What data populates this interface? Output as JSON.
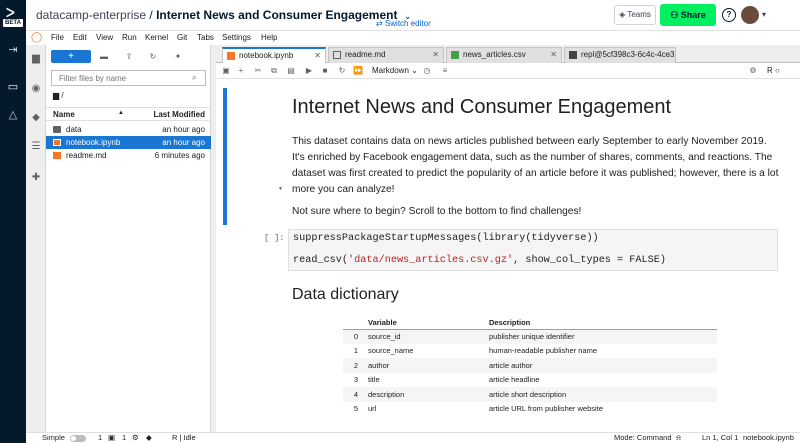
{
  "rail": {
    "beta": "BETA"
  },
  "header": {
    "workspace": "datacamp-enterprise",
    "separator": "/",
    "title": "Internet News and Consumer Engagement",
    "switch_editor": "Switch editor",
    "teams": "Teams",
    "share": "Share",
    "help": "?"
  },
  "menu": [
    "File",
    "Edit",
    "View",
    "Run",
    "Kernel",
    "Git",
    "Tabs",
    "Settings",
    "Help"
  ],
  "filebrowser": {
    "new_button": "+",
    "filter_placeholder": "Filter files by name",
    "path": "/",
    "col_name": "Name",
    "col_modified": "Last Modified",
    "files": [
      {
        "name": "data",
        "modified": "an hour ago",
        "type": "folder"
      },
      {
        "name": "notebook.ipynb",
        "modified": "an hour ago",
        "type": "notebook"
      },
      {
        "name": "readme.md",
        "modified": "6 minutes ago",
        "type": "markdown"
      }
    ]
  },
  "tabs": [
    {
      "label": "notebook.ipynb"
    },
    {
      "label": "readme.md"
    },
    {
      "label": "news_articles.csv"
    },
    {
      "label": "repl@5cf398c3-6c4c-4ce3"
    }
  ],
  "toolbar": {
    "cell_type": "Markdown",
    "kernel": "R"
  },
  "notebook": {
    "title": "Internet News and Consumer Engagement",
    "intro": "This dataset contains data on news articles published between early September to early November 2019. It's enriched by Facebook engagement data, such as the number of shares, comments, and reactions. The dataset was first created to predict the popularity of an article before it was published; however, there is a lot more you can analyze!",
    "hint": "Not sure where to begin? Scroll to the bottom to find challenges!",
    "prompt": "[ ]:",
    "code_line1": "suppressPackageStartupMessages(library(tidyverse))",
    "code_line2_fn": "read_csv(",
    "code_line2_str": "'data/news_articles.csv.gz'",
    "code_line2_rest": ", show_col_types = FALSE)",
    "h2": "Data dictionary",
    "dict_headers": [
      "Variable",
      "Description"
    ],
    "dict_rows": [
      [
        "0",
        "source_id",
        "publisher unique identifier"
      ],
      [
        "1",
        "source_name",
        "human-readable publisher name"
      ],
      [
        "2",
        "author",
        "article author"
      ],
      [
        "3",
        "title",
        "article headline"
      ],
      [
        "4",
        "description",
        "article short description"
      ],
      [
        "5",
        "url",
        "article URL from publisher website"
      ]
    ]
  },
  "status": {
    "simple": "Simple",
    "terminals": "1",
    "kernels": "1",
    "kernel_state": "R | Idle",
    "mode": "Mode: Command",
    "position": "Ln 1, Col 1",
    "file": "notebook.ipynb"
  }
}
